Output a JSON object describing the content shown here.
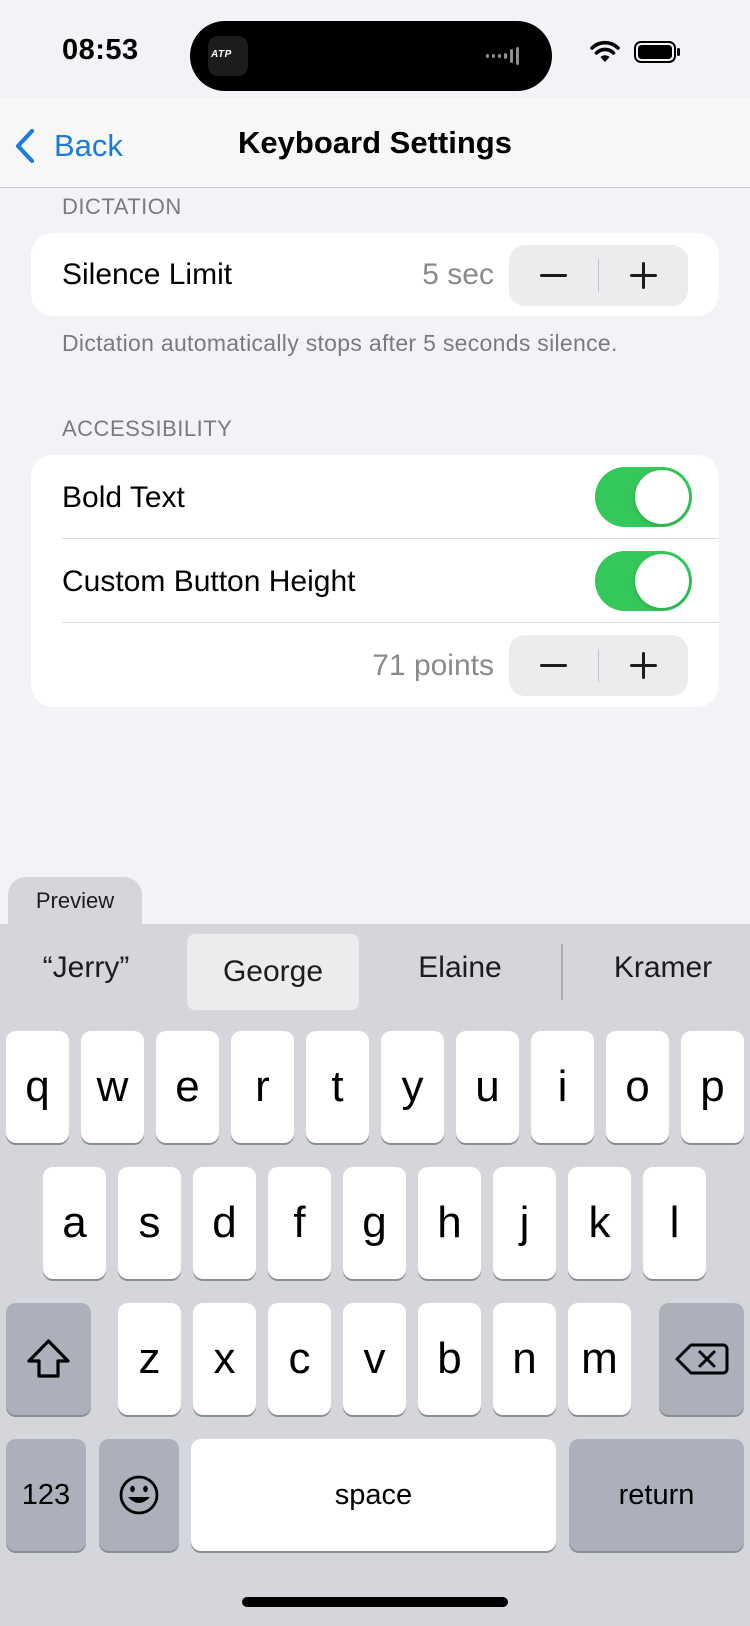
{
  "status_bar": {
    "time": "08:53",
    "island_app_label": "ATP"
  },
  "nav": {
    "back_label": "Back",
    "title": "Keyboard Settings"
  },
  "dictation": {
    "header": "DICTATION",
    "silence_label": "Silence Limit",
    "silence_value": "5 sec",
    "footer": "Dictation automatically stops after 5 seconds silence."
  },
  "accessibility": {
    "header": "ACCESSIBILITY",
    "bold_text_label": "Bold Text",
    "bold_text_on": true,
    "custom_height_label": "Custom Button Height",
    "custom_height_on": true,
    "height_value": "71 points"
  },
  "keyboard": {
    "preview_label": "Preview",
    "suggestions": [
      "“Jerry”",
      "George",
      "Elaine",
      "Kramer"
    ],
    "selected_suggestion": "George",
    "row1": [
      "q",
      "w",
      "e",
      "r",
      "t",
      "y",
      "u",
      "i",
      "o",
      "p"
    ],
    "row2": [
      "a",
      "s",
      "d",
      "f",
      "g",
      "h",
      "j",
      "k",
      "l"
    ],
    "row3": [
      "z",
      "x",
      "c",
      "v",
      "b",
      "n",
      "m"
    ],
    "numbers_label": "123",
    "space_label": "space",
    "return_label": "return"
  },
  "colors": {
    "accent": "#1a7ae0",
    "toggle_on": "#34c759",
    "background": "#f2f2f7"
  },
  "icons": [
    "chevron-left-icon",
    "wifi-icon",
    "battery-icon",
    "minus-icon",
    "plus-icon",
    "shift-icon",
    "delete-icon",
    "emoji-icon"
  ]
}
